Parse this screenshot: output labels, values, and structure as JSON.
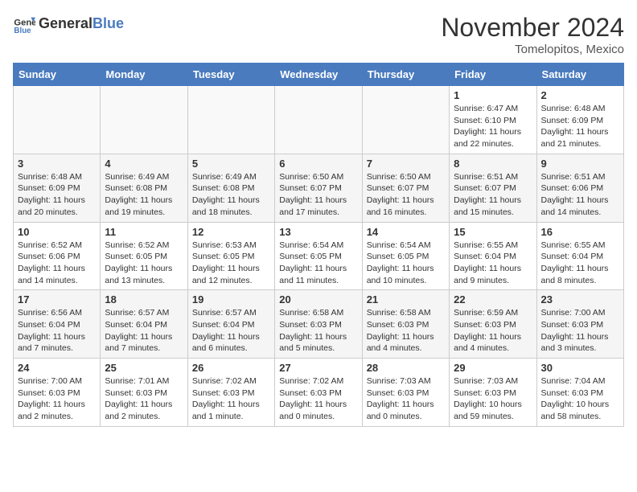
{
  "header": {
    "logo_general": "General",
    "logo_blue": "Blue",
    "month_title": "November 2024",
    "location": "Tomelopitos, Mexico"
  },
  "days_of_week": [
    "Sunday",
    "Monday",
    "Tuesday",
    "Wednesday",
    "Thursday",
    "Friday",
    "Saturday"
  ],
  "weeks": [
    [
      {
        "day": "",
        "empty": true
      },
      {
        "day": "",
        "empty": true
      },
      {
        "day": "",
        "empty": true
      },
      {
        "day": "",
        "empty": true
      },
      {
        "day": "",
        "empty": true
      },
      {
        "day": "1",
        "sunrise": "6:47 AM",
        "sunset": "6:10 PM",
        "daylight": "11 hours and 22 minutes."
      },
      {
        "day": "2",
        "sunrise": "6:48 AM",
        "sunset": "6:09 PM",
        "daylight": "11 hours and 21 minutes."
      }
    ],
    [
      {
        "day": "3",
        "sunrise": "6:48 AM",
        "sunset": "6:09 PM",
        "daylight": "11 hours and 20 minutes."
      },
      {
        "day": "4",
        "sunrise": "6:49 AM",
        "sunset": "6:08 PM",
        "daylight": "11 hours and 19 minutes."
      },
      {
        "day": "5",
        "sunrise": "6:49 AM",
        "sunset": "6:08 PM",
        "daylight": "11 hours and 18 minutes."
      },
      {
        "day": "6",
        "sunrise": "6:50 AM",
        "sunset": "6:07 PM",
        "daylight": "11 hours and 17 minutes."
      },
      {
        "day": "7",
        "sunrise": "6:50 AM",
        "sunset": "6:07 PM",
        "daylight": "11 hours and 16 minutes."
      },
      {
        "day": "8",
        "sunrise": "6:51 AM",
        "sunset": "6:07 PM",
        "daylight": "11 hours and 15 minutes."
      },
      {
        "day": "9",
        "sunrise": "6:51 AM",
        "sunset": "6:06 PM",
        "daylight": "11 hours and 14 minutes."
      }
    ],
    [
      {
        "day": "10",
        "sunrise": "6:52 AM",
        "sunset": "6:06 PM",
        "daylight": "11 hours and 14 minutes."
      },
      {
        "day": "11",
        "sunrise": "6:52 AM",
        "sunset": "6:05 PM",
        "daylight": "11 hours and 13 minutes."
      },
      {
        "day": "12",
        "sunrise": "6:53 AM",
        "sunset": "6:05 PM",
        "daylight": "11 hours and 12 minutes."
      },
      {
        "day": "13",
        "sunrise": "6:54 AM",
        "sunset": "6:05 PM",
        "daylight": "11 hours and 11 minutes."
      },
      {
        "day": "14",
        "sunrise": "6:54 AM",
        "sunset": "6:05 PM",
        "daylight": "11 hours and 10 minutes."
      },
      {
        "day": "15",
        "sunrise": "6:55 AM",
        "sunset": "6:04 PM",
        "daylight": "11 hours and 9 minutes."
      },
      {
        "day": "16",
        "sunrise": "6:55 AM",
        "sunset": "6:04 PM",
        "daylight": "11 hours and 8 minutes."
      }
    ],
    [
      {
        "day": "17",
        "sunrise": "6:56 AM",
        "sunset": "6:04 PM",
        "daylight": "11 hours and 7 minutes."
      },
      {
        "day": "18",
        "sunrise": "6:57 AM",
        "sunset": "6:04 PM",
        "daylight": "11 hours and 7 minutes."
      },
      {
        "day": "19",
        "sunrise": "6:57 AM",
        "sunset": "6:04 PM",
        "daylight": "11 hours and 6 minutes."
      },
      {
        "day": "20",
        "sunrise": "6:58 AM",
        "sunset": "6:03 PM",
        "daylight": "11 hours and 5 minutes."
      },
      {
        "day": "21",
        "sunrise": "6:58 AM",
        "sunset": "6:03 PM",
        "daylight": "11 hours and 4 minutes."
      },
      {
        "day": "22",
        "sunrise": "6:59 AM",
        "sunset": "6:03 PM",
        "daylight": "11 hours and 4 minutes."
      },
      {
        "day": "23",
        "sunrise": "7:00 AM",
        "sunset": "6:03 PM",
        "daylight": "11 hours and 3 minutes."
      }
    ],
    [
      {
        "day": "24",
        "sunrise": "7:00 AM",
        "sunset": "6:03 PM",
        "daylight": "11 hours and 2 minutes."
      },
      {
        "day": "25",
        "sunrise": "7:01 AM",
        "sunset": "6:03 PM",
        "daylight": "11 hours and 2 minutes."
      },
      {
        "day": "26",
        "sunrise": "7:02 AM",
        "sunset": "6:03 PM",
        "daylight": "11 hours and 1 minute."
      },
      {
        "day": "27",
        "sunrise": "7:02 AM",
        "sunset": "6:03 PM",
        "daylight": "11 hours and 0 minutes."
      },
      {
        "day": "28",
        "sunrise": "7:03 AM",
        "sunset": "6:03 PM",
        "daylight": "11 hours and 0 minutes."
      },
      {
        "day": "29",
        "sunrise": "7:03 AM",
        "sunset": "6:03 PM",
        "daylight": "10 hours and 59 minutes."
      },
      {
        "day": "30",
        "sunrise": "7:04 AM",
        "sunset": "6:03 PM",
        "daylight": "10 hours and 58 minutes."
      }
    ]
  ]
}
